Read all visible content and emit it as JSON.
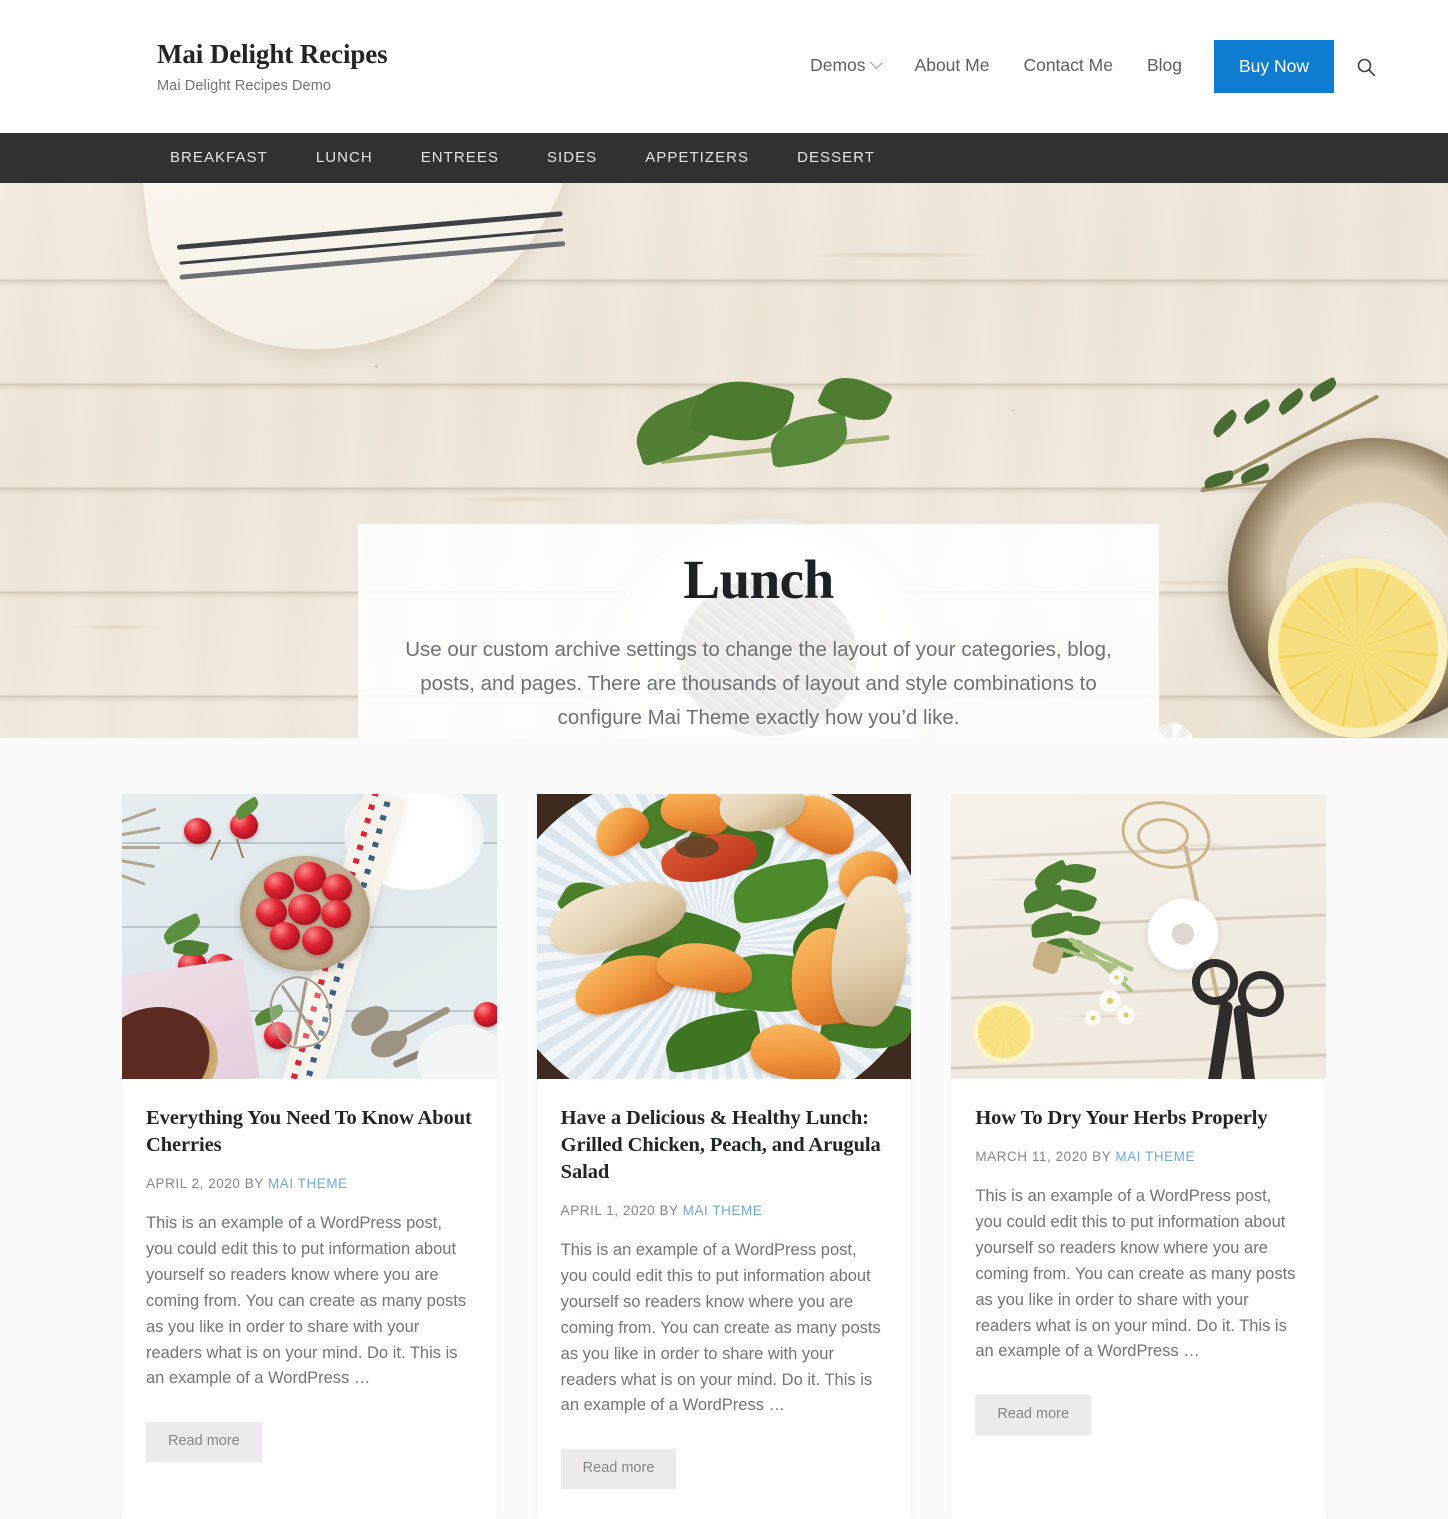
{
  "header": {
    "site_title": "Mai Delight Recipes",
    "tagline": "Mai Delight Recipes Demo",
    "nav": [
      {
        "label": "Demos",
        "has_dropdown": true,
        "icon": "chevron-down-icon"
      },
      {
        "label": "About Me",
        "has_dropdown": false
      },
      {
        "label": "Contact Me",
        "has_dropdown": false
      },
      {
        "label": "Blog",
        "has_dropdown": false
      }
    ],
    "cta": {
      "label": "Buy Now",
      "color": "#0d7cd1"
    },
    "search_icon": "search-icon"
  },
  "subnav": {
    "items": [
      {
        "label": "BREAKFAST"
      },
      {
        "label": "LUNCH"
      },
      {
        "label": "ENTREES"
      },
      {
        "label": "SIDES"
      },
      {
        "label": "APPETIZERS"
      },
      {
        "label": "DESSERT"
      }
    ]
  },
  "hero": {
    "title": "Lunch",
    "description": "Use our custom archive settings to change the layout of your categories, blog, posts, and pages. There are thousands of layout and style combinations to configure Mai Theme exactly how you’d like."
  },
  "posts": [
    {
      "image_alt": "cherries-in-bowl-photo",
      "title": "Everything You Need To Know About Cherries",
      "date": "APRIL 2, 2020",
      "by_label": "BY",
      "author": "MAI THEME",
      "excerpt": "This is an example of a WordPress post, you could edit this to put information about yourself so readers know where you are coming from. You can create as many posts as you like in order to share with your readers what is on your mind. Do it. This is an example of a WordPress …",
      "read_more": "Read more"
    },
    {
      "image_alt": "grilled-chicken-peach-arugula-salad-photo",
      "title": "Have a Delicious & Healthy Lunch: Grilled Chicken, Peach, and Arugula Salad",
      "date": "APRIL 1, 2020",
      "by_label": "BY",
      "author": "MAI THEME",
      "excerpt": "This is an example of a WordPress post, you could edit this to put information about yourself so readers know where you are coming from. You can create as many posts as you like in order to share with your readers what is on your mind. Do it. This is an example of a WordPress …",
      "read_more": "Read more"
    },
    {
      "image_alt": "drying-herbs-scissors-twine-photo",
      "title": "How To Dry Your Herbs Properly",
      "date": "MARCH 11, 2020",
      "by_label": "BY",
      "author": "MAI THEME",
      "excerpt": "This is an example of a WordPress post, you could edit this to put information about yourself so readers know where you are coming from. You can create as many posts as you like in order to share with your readers what is on your mind. Do it. This is an example of a WordPress …",
      "read_more": "Read more"
    }
  ],
  "colors": {
    "accent": "#0d7cd1",
    "subnav_bg": "#2f3133",
    "link": "#6ea8d8",
    "page_bg": "#fbfbfb",
    "button_bg": "#eceaec"
  }
}
